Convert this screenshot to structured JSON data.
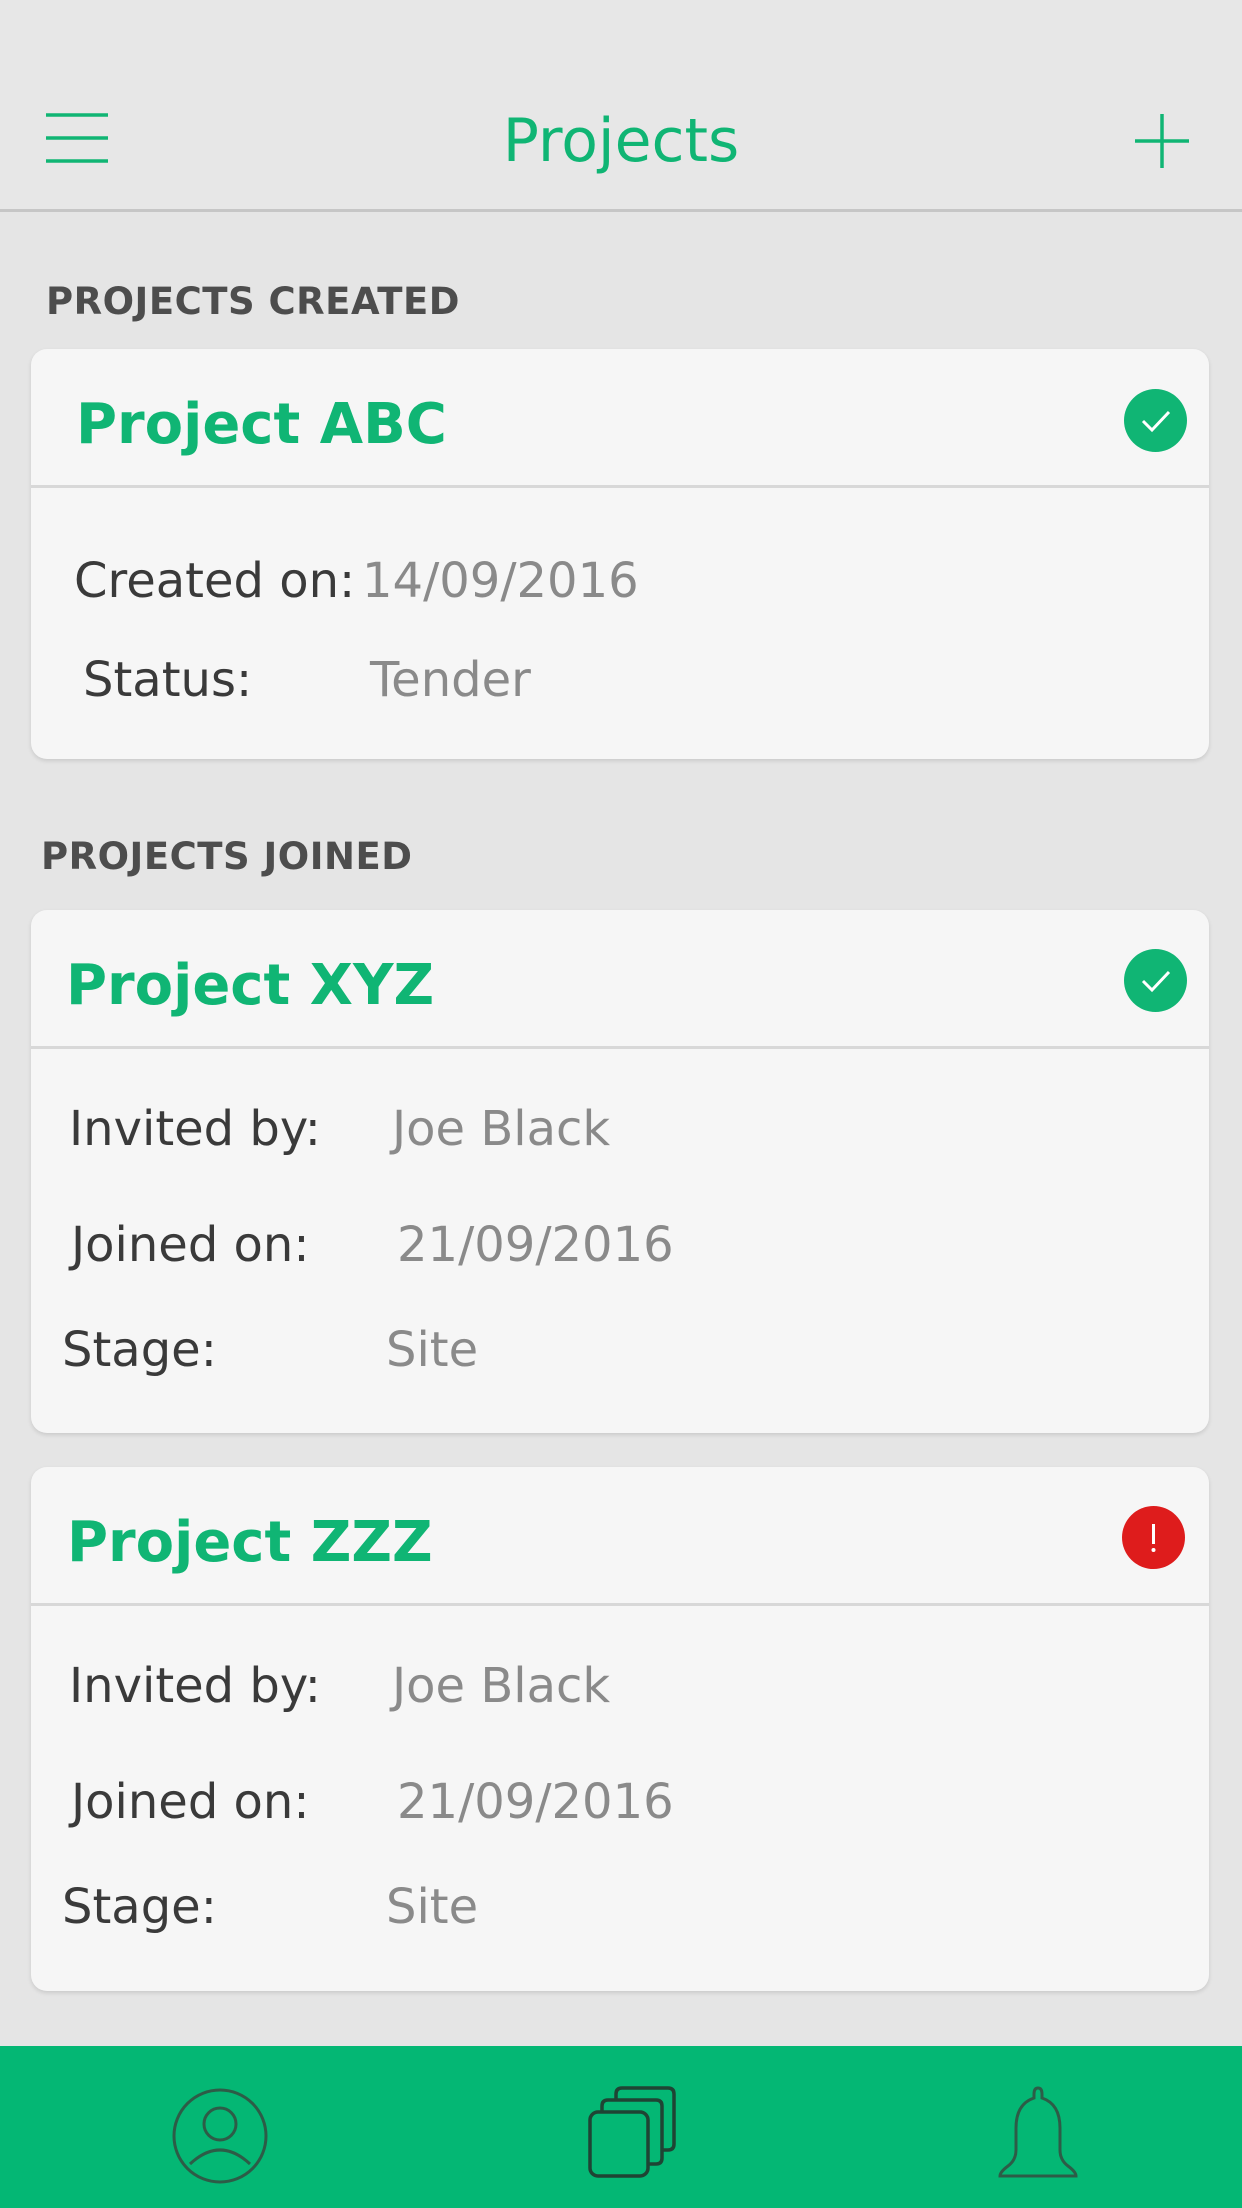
{
  "header": {
    "title": "Projects",
    "menu_icon": "hamburger-menu-icon",
    "add_icon": "plus-icon"
  },
  "colors": {
    "accent": "#10b574",
    "tabbar": "#04b774",
    "alert": "#de1c1c",
    "background": "#e5e5e5",
    "card": "#f6f6f6"
  },
  "sections": {
    "created_title": "PROJECTS CREATED",
    "joined_title": "PROJECTS JOINED"
  },
  "projects_created": [
    {
      "name": "Project ABC",
      "status_icon": "check-circle-icon",
      "created_label": "Created on:",
      "created_value": "14/09/2016",
      "status_label": "Status:",
      "status_value": "Tender"
    }
  ],
  "projects_joined": [
    {
      "name": "Project XYZ",
      "status_icon": "check-circle-icon",
      "invited_label": "Invited by:",
      "invited_value": "Joe Black",
      "joined_label": "Joined on:",
      "joined_value": "21/09/2016",
      "stage_label": "Stage:",
      "stage_value": "Site"
    },
    {
      "name": "Project ZZZ",
      "status_icon": "alert-circle-icon",
      "invited_label": "Invited by:",
      "invited_value": "Joe Black",
      "joined_label": "Joined on:",
      "joined_value": "21/09/2016",
      "stage_label": "Stage:",
      "stage_value": "Site"
    }
  ],
  "tabbar": {
    "items": [
      {
        "icon": "profile-icon"
      },
      {
        "icon": "projects-icon"
      },
      {
        "icon": "bell-icon"
      }
    ]
  }
}
